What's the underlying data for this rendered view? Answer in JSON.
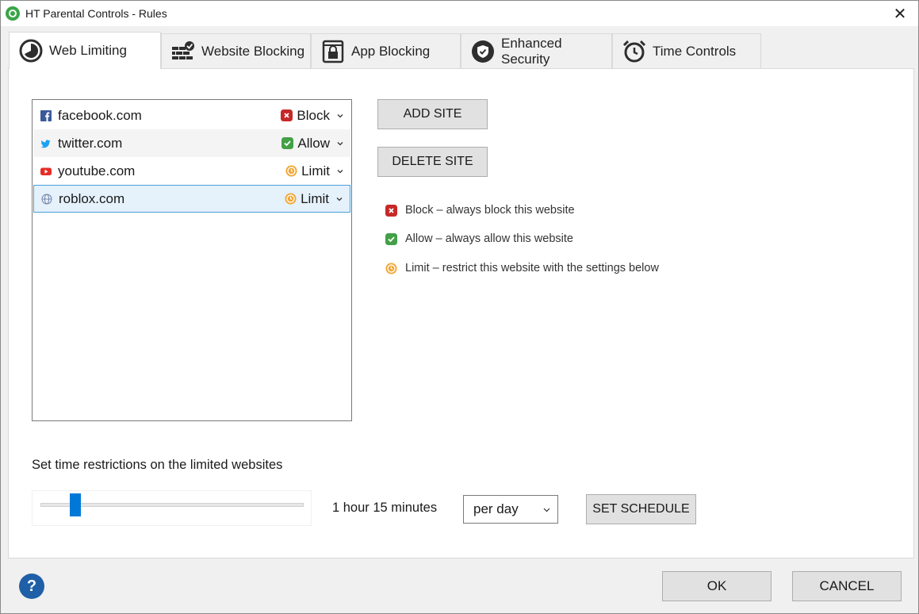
{
  "window": {
    "title": "HT Parental Controls - Rules",
    "close_glyph": "✕"
  },
  "tabs": [
    {
      "label": "Web Limiting",
      "icon": "web-limiting-icon",
      "active": true
    },
    {
      "label": "Website Blocking",
      "icon": "firewall-icon"
    },
    {
      "label": "App Blocking",
      "icon": "app-lock-icon"
    },
    {
      "label": "Enhanced Security",
      "icon": "shield-icon"
    },
    {
      "label": "Time Controls",
      "icon": "alarm-clock-icon"
    }
  ],
  "sites": [
    {
      "name": "facebook.com",
      "status": "Block",
      "favicon": "facebook-icon"
    },
    {
      "name": "twitter.com",
      "status": "Allow",
      "favicon": "twitter-icon"
    },
    {
      "name": "youtube.com",
      "status": "Limit",
      "favicon": "youtube-icon"
    },
    {
      "name": "roblox.com",
      "status": "Limit",
      "favicon": "globe-icon",
      "selected": true
    }
  ],
  "buttons": {
    "add_site": "ADD SITE",
    "delete_site": "DELETE SITE",
    "set_schedule": "SET SCHEDULE",
    "ok": "OK",
    "cancel": "CANCEL"
  },
  "legend": [
    {
      "text": "Block – always block this website",
      "icon": "block-icon"
    },
    {
      "text": "Allow – always allow this website",
      "icon": "allow-icon"
    },
    {
      "text": "Limit – restrict this website with the settings below",
      "icon": "limit-icon"
    }
  ],
  "restrictions": {
    "label": "Set time restrictions on the limited websites",
    "duration": "1 hour 15 minutes",
    "period": "per day"
  },
  "help_glyph": "?",
  "colors": {
    "block": "#c62828",
    "allow": "#43a047",
    "limit": "#f2a531",
    "accent": "#0078d7",
    "selection": "#e5f1fb"
  }
}
